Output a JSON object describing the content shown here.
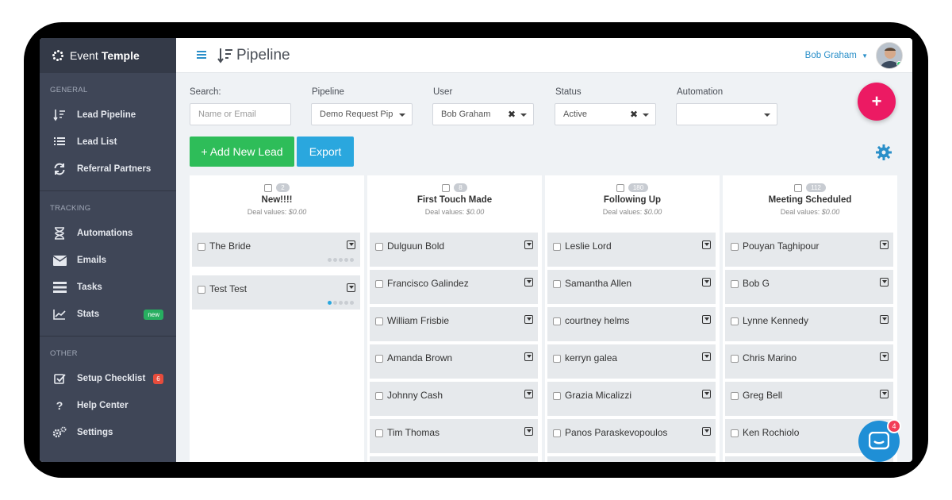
{
  "brand": {
    "prefix": "Event",
    "name": "Temple"
  },
  "sidebar": {
    "sections": [
      {
        "title": "GENERAL",
        "items": [
          {
            "label": "Lead Pipeline",
            "icon": "pipeline-icon"
          },
          {
            "label": "Lead List",
            "icon": "list-icon"
          },
          {
            "label": "Referral Partners",
            "icon": "refresh-icon"
          }
        ]
      },
      {
        "title": "TRACKING",
        "items": [
          {
            "label": "Automations",
            "icon": "hourglass-icon"
          },
          {
            "label": "Emails",
            "icon": "envelope-icon"
          },
          {
            "label": "Tasks",
            "icon": "tasks-icon"
          },
          {
            "label": "Stats",
            "icon": "chart-icon",
            "badge": "new"
          }
        ]
      },
      {
        "title": "OTHER",
        "items": [
          {
            "label": "Setup Checklist",
            "icon": "checklist-icon",
            "count": "6"
          },
          {
            "label": "Help Center",
            "icon": "question-icon"
          },
          {
            "label": "Settings",
            "icon": "gears-icon"
          }
        ]
      }
    ]
  },
  "header": {
    "title": "Pipeline",
    "user": "Bob Graham"
  },
  "filters": {
    "search_label": "Search:",
    "search_placeholder": "Name or Email",
    "pipeline_label": "Pipeline",
    "pipeline_value": "Demo Request Pip",
    "user_label": "User",
    "user_value": "Bob Graham",
    "status_label": "Status",
    "status_value": "Active",
    "automation_label": "Automation",
    "automation_value": ""
  },
  "actions": {
    "add_lead": "+ Add New Lead",
    "export": "Export",
    "fab": "+"
  },
  "deal_prefix": "Deal values:",
  "columns": [
    {
      "title": "New!!!!",
      "count": "2",
      "deal": "$0.00",
      "cards": [
        {
          "name": "The Bride",
          "dots": 0
        },
        {
          "name": "Test Test",
          "dots": 1
        }
      ]
    },
    {
      "title": "First Touch Made",
      "count": "8",
      "deal": "$0.00",
      "cards": [
        {
          "name": "Dulguun Bold"
        },
        {
          "name": "Francisco Galindez"
        },
        {
          "name": "William Frisbie"
        },
        {
          "name": "Amanda Brown"
        },
        {
          "name": "Johnny Cash"
        },
        {
          "name": "Tim Thomas"
        }
      ]
    },
    {
      "title": "Following Up",
      "count": "180",
      "deal": "$0.00",
      "cards": [
        {
          "name": "Leslie Lord"
        },
        {
          "name": "Samantha Allen"
        },
        {
          "name": "courtney helms"
        },
        {
          "name": "kerryn galea"
        },
        {
          "name": "Grazia Micalizzi"
        },
        {
          "name": "Panos Paraskevopoulos"
        }
      ]
    },
    {
      "title": "Meeting Scheduled",
      "count": "112",
      "deal": "$0.00",
      "cards": [
        {
          "name": "Pouyan Taghipour"
        },
        {
          "name": "Bob G"
        },
        {
          "name": "Lynne Kennedy"
        },
        {
          "name": "Chris Marino"
        },
        {
          "name": "Greg Bell"
        },
        {
          "name": "Ken Rochiolo"
        }
      ]
    }
  ],
  "chat": {
    "badge": "4"
  },
  "colors": {
    "sidebar": "#3f4657",
    "accent": "#2a8fc9",
    "add": "#2ebd59",
    "export": "#2aa7de",
    "fab": "#ec1a63"
  }
}
